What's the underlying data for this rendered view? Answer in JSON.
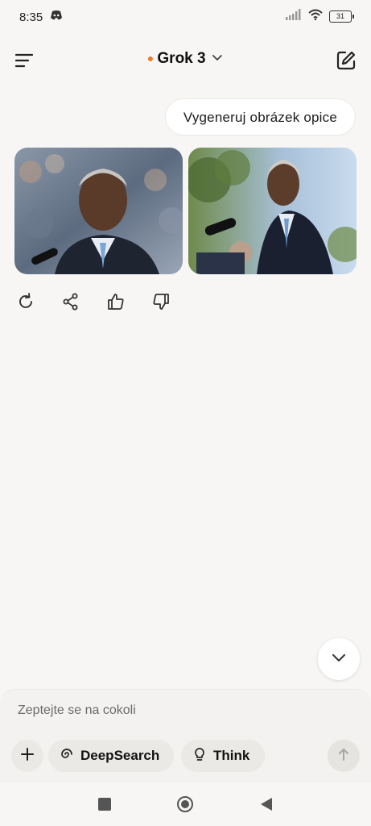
{
  "status_bar": {
    "time": "8:35",
    "battery": "31",
    "icons": [
      "discord-icon",
      "signal-icon",
      "wifi-icon",
      "battery-icon"
    ]
  },
  "header": {
    "model_name": "Grok 3",
    "model_dot_color": "#f07c2c",
    "icons": [
      "menu-icon",
      "chevron-down-icon",
      "new-chat-icon"
    ]
  },
  "conversation": {
    "user_message": "Vygeneruj obrázek opice",
    "generated_images": [
      "generated-image",
      "generated-image"
    ],
    "actions": [
      "regenerate-icon",
      "share-icon",
      "thumbs-up-icon",
      "thumbs-down-icon"
    ]
  },
  "composer": {
    "placeholder": "Zeptejte se na cokoli",
    "deepsearch_label": "DeepSearch",
    "think_label": "Think",
    "icons": [
      "plus-icon",
      "deepsearch-icon",
      "lightbulb-icon",
      "arrow-up-icon"
    ]
  },
  "navigation": {
    "icons": [
      "square-icon",
      "home-circle-icon",
      "back-triangle-icon"
    ]
  },
  "colors": {
    "background": "#f7f6f4",
    "accent_dot": "#f07c2c"
  }
}
